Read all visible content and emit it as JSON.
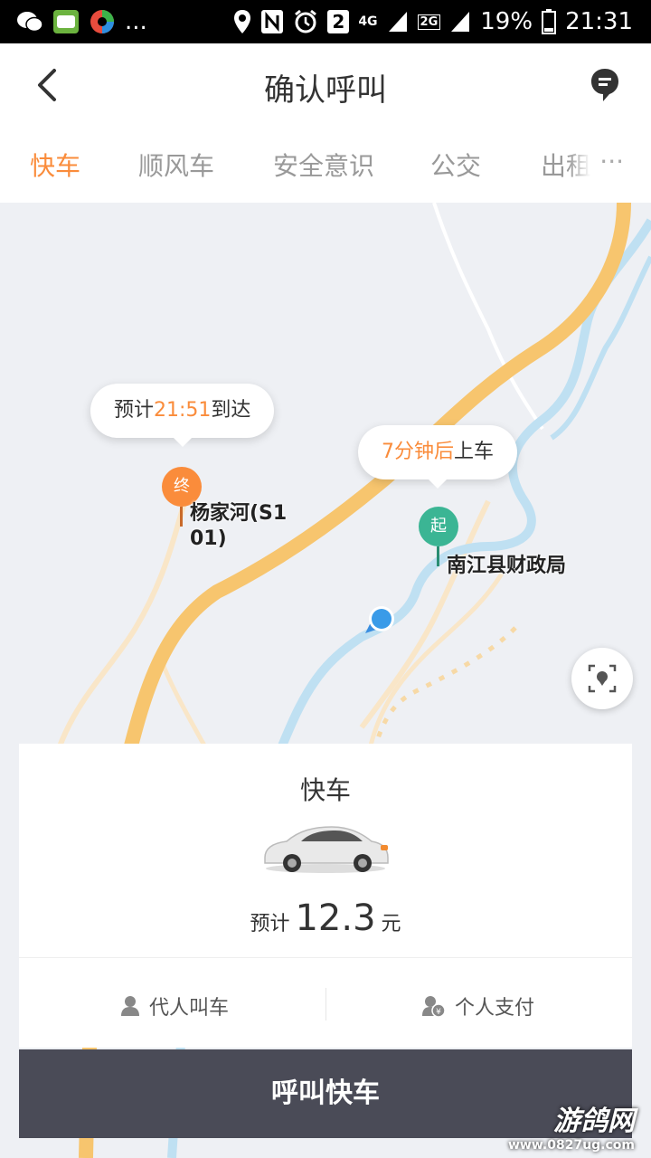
{
  "status_bar": {
    "left_icons": [
      "wechat-icon",
      "app-icon",
      "browser-icon"
    ],
    "more": "...",
    "sim_slot": "2",
    "network": "4G",
    "network2": "2G",
    "battery": "19%",
    "time": "21:31"
  },
  "header": {
    "title": "确认呼叫"
  },
  "tabs": [
    {
      "label": "快车",
      "active": true
    },
    {
      "label": "顺风车",
      "active": false
    },
    {
      "label": "安全意识",
      "active": false
    },
    {
      "label": "公交",
      "active": false
    },
    {
      "label": "出租",
      "active": false
    }
  ],
  "tabs_more": "···",
  "map": {
    "arrival_bubble": {
      "prefix": "预计",
      "time": "21:51",
      "suffix": "到达"
    },
    "pickup_bubble": {
      "highlight": "7分钟后",
      "suffix": "上车"
    },
    "destination": {
      "marker": "终",
      "label_line1": "杨家河(S1",
      "label_line2": "01)"
    },
    "origin": {
      "marker": "起",
      "label": "南江县财政局"
    }
  },
  "card": {
    "title": "快车",
    "price_label": "预计",
    "price": "12.3",
    "price_unit": "元",
    "option_left": "代人叫车",
    "option_right": "个人支付"
  },
  "call_button": "呼叫快车",
  "watermark": {
    "title": "游鸽网",
    "url": "www.0827ug.com"
  },
  "colors": {
    "accent": "#fa8c3b",
    "origin_green": "#3bb594",
    "button_dark": "#4a4b57",
    "road_yellow": "#f7c56e",
    "river_blue": "#bfe0f2"
  }
}
